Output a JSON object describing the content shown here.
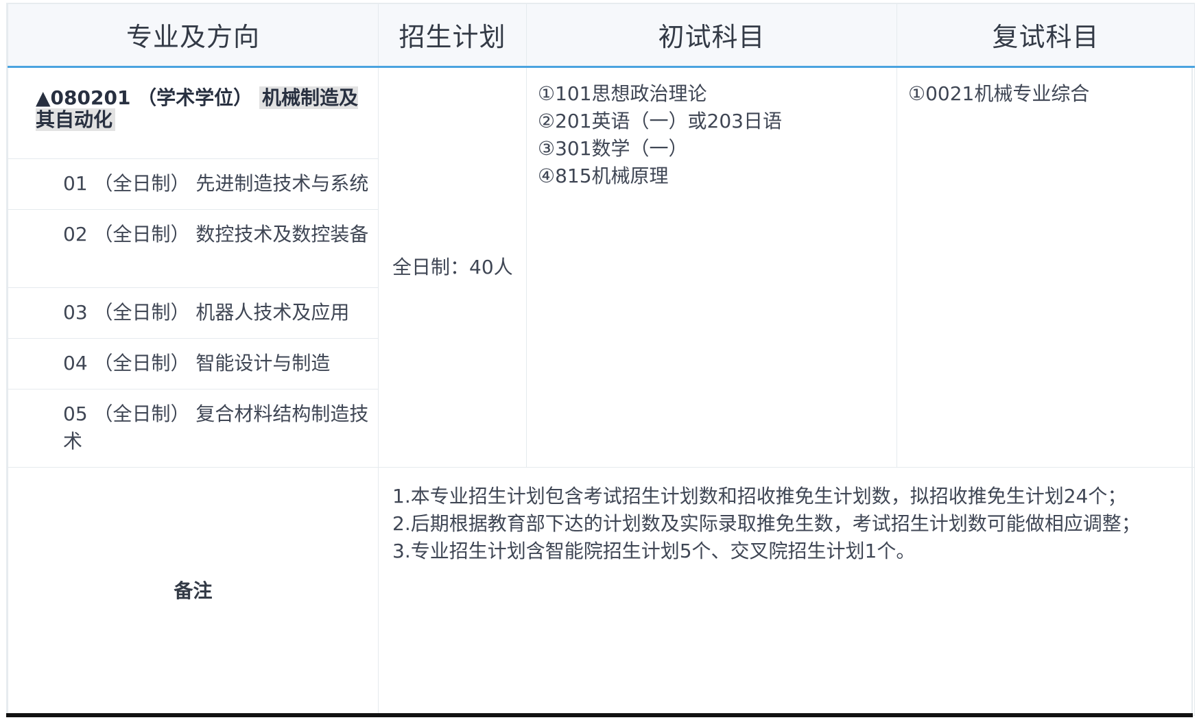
{
  "header": {
    "col_major": "专业及方向",
    "col_plan": "招生计划",
    "col_initial": "初试科目",
    "col_retest": "复试科目"
  },
  "major": {
    "code_prefix": "▲080201 （学术学位） ",
    "name": "机械制造及其自动化"
  },
  "directions": [
    "01 （全日制） 先进制造技术与系统",
    "02 （全日制） 数控技术及数控装备",
    "03 （全日制） 机器人技术及应用",
    "04 （全日制） 智能设计与制造",
    "05 （全日制） 复合材料结构制造技术"
  ],
  "plan": "全日制：40人",
  "initial_subjects": [
    "①101思想政治理论",
    "②201英语（一）或203日语",
    "③301数学（一）",
    "④815机械原理"
  ],
  "retest_subjects": [
    "①0021机械专业综合"
  ],
  "remarks": {
    "label": "备注",
    "items": [
      "1.本专业招生计划包含考试招生计划数和招收推免生计划数，拟招收推免生计划24个；",
      "2.后期根据教育部下达的计划数及实际录取推免生数，考试招生计划数可能做相应调整；",
      "3.专业招生计划含智能院招生计划5个、交叉院招生计划1个。"
    ]
  }
}
